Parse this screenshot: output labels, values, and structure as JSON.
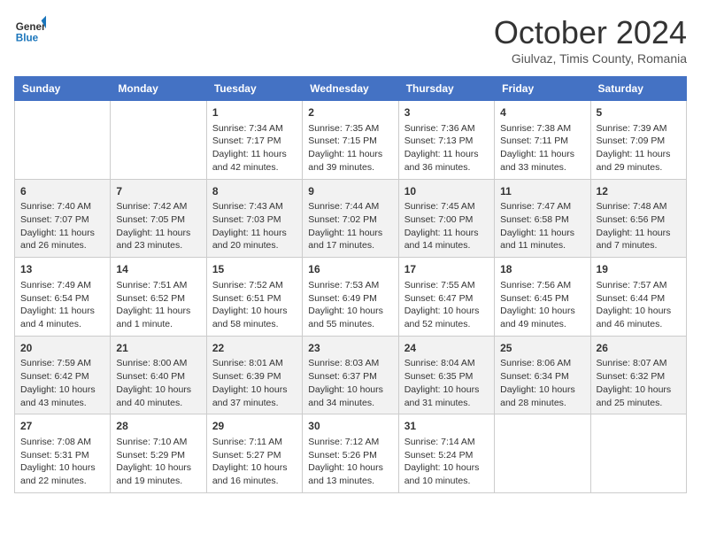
{
  "header": {
    "logo_line1": "General",
    "logo_line2": "Blue",
    "month": "October 2024",
    "location": "Giulvaz, Timis County, Romania"
  },
  "days_of_week": [
    "Sunday",
    "Monday",
    "Tuesday",
    "Wednesday",
    "Thursday",
    "Friday",
    "Saturday"
  ],
  "weeks": [
    [
      {
        "day": "",
        "sunrise": "",
        "sunset": "",
        "daylight": ""
      },
      {
        "day": "",
        "sunrise": "",
        "sunset": "",
        "daylight": ""
      },
      {
        "day": "1",
        "sunrise": "Sunrise: 7:34 AM",
        "sunset": "Sunset: 7:17 PM",
        "daylight": "Daylight: 11 hours and 42 minutes."
      },
      {
        "day": "2",
        "sunrise": "Sunrise: 7:35 AM",
        "sunset": "Sunset: 7:15 PM",
        "daylight": "Daylight: 11 hours and 39 minutes."
      },
      {
        "day": "3",
        "sunrise": "Sunrise: 7:36 AM",
        "sunset": "Sunset: 7:13 PM",
        "daylight": "Daylight: 11 hours and 36 minutes."
      },
      {
        "day": "4",
        "sunrise": "Sunrise: 7:38 AM",
        "sunset": "Sunset: 7:11 PM",
        "daylight": "Daylight: 11 hours and 33 minutes."
      },
      {
        "day": "5",
        "sunrise": "Sunrise: 7:39 AM",
        "sunset": "Sunset: 7:09 PM",
        "daylight": "Daylight: 11 hours and 29 minutes."
      }
    ],
    [
      {
        "day": "6",
        "sunrise": "Sunrise: 7:40 AM",
        "sunset": "Sunset: 7:07 PM",
        "daylight": "Daylight: 11 hours and 26 minutes."
      },
      {
        "day": "7",
        "sunrise": "Sunrise: 7:42 AM",
        "sunset": "Sunset: 7:05 PM",
        "daylight": "Daylight: 11 hours and 23 minutes."
      },
      {
        "day": "8",
        "sunrise": "Sunrise: 7:43 AM",
        "sunset": "Sunset: 7:03 PM",
        "daylight": "Daylight: 11 hours and 20 minutes."
      },
      {
        "day": "9",
        "sunrise": "Sunrise: 7:44 AM",
        "sunset": "Sunset: 7:02 PM",
        "daylight": "Daylight: 11 hours and 17 minutes."
      },
      {
        "day": "10",
        "sunrise": "Sunrise: 7:45 AM",
        "sunset": "Sunset: 7:00 PM",
        "daylight": "Daylight: 11 hours and 14 minutes."
      },
      {
        "day": "11",
        "sunrise": "Sunrise: 7:47 AM",
        "sunset": "Sunset: 6:58 PM",
        "daylight": "Daylight: 11 hours and 11 minutes."
      },
      {
        "day": "12",
        "sunrise": "Sunrise: 7:48 AM",
        "sunset": "Sunset: 6:56 PM",
        "daylight": "Daylight: 11 hours and 7 minutes."
      }
    ],
    [
      {
        "day": "13",
        "sunrise": "Sunrise: 7:49 AM",
        "sunset": "Sunset: 6:54 PM",
        "daylight": "Daylight: 11 hours and 4 minutes."
      },
      {
        "day": "14",
        "sunrise": "Sunrise: 7:51 AM",
        "sunset": "Sunset: 6:52 PM",
        "daylight": "Daylight: 11 hours and 1 minute."
      },
      {
        "day": "15",
        "sunrise": "Sunrise: 7:52 AM",
        "sunset": "Sunset: 6:51 PM",
        "daylight": "Daylight: 10 hours and 58 minutes."
      },
      {
        "day": "16",
        "sunrise": "Sunrise: 7:53 AM",
        "sunset": "Sunset: 6:49 PM",
        "daylight": "Daylight: 10 hours and 55 minutes."
      },
      {
        "day": "17",
        "sunrise": "Sunrise: 7:55 AM",
        "sunset": "Sunset: 6:47 PM",
        "daylight": "Daylight: 10 hours and 52 minutes."
      },
      {
        "day": "18",
        "sunrise": "Sunrise: 7:56 AM",
        "sunset": "Sunset: 6:45 PM",
        "daylight": "Daylight: 10 hours and 49 minutes."
      },
      {
        "day": "19",
        "sunrise": "Sunrise: 7:57 AM",
        "sunset": "Sunset: 6:44 PM",
        "daylight": "Daylight: 10 hours and 46 minutes."
      }
    ],
    [
      {
        "day": "20",
        "sunrise": "Sunrise: 7:59 AM",
        "sunset": "Sunset: 6:42 PM",
        "daylight": "Daylight: 10 hours and 43 minutes."
      },
      {
        "day": "21",
        "sunrise": "Sunrise: 8:00 AM",
        "sunset": "Sunset: 6:40 PM",
        "daylight": "Daylight: 10 hours and 40 minutes."
      },
      {
        "day": "22",
        "sunrise": "Sunrise: 8:01 AM",
        "sunset": "Sunset: 6:39 PM",
        "daylight": "Daylight: 10 hours and 37 minutes."
      },
      {
        "day": "23",
        "sunrise": "Sunrise: 8:03 AM",
        "sunset": "Sunset: 6:37 PM",
        "daylight": "Daylight: 10 hours and 34 minutes."
      },
      {
        "day": "24",
        "sunrise": "Sunrise: 8:04 AM",
        "sunset": "Sunset: 6:35 PM",
        "daylight": "Daylight: 10 hours and 31 minutes."
      },
      {
        "day": "25",
        "sunrise": "Sunrise: 8:06 AM",
        "sunset": "Sunset: 6:34 PM",
        "daylight": "Daylight: 10 hours and 28 minutes."
      },
      {
        "day": "26",
        "sunrise": "Sunrise: 8:07 AM",
        "sunset": "Sunset: 6:32 PM",
        "daylight": "Daylight: 10 hours and 25 minutes."
      }
    ],
    [
      {
        "day": "27",
        "sunrise": "Sunrise: 7:08 AM",
        "sunset": "Sunset: 5:31 PM",
        "daylight": "Daylight: 10 hours and 22 minutes."
      },
      {
        "day": "28",
        "sunrise": "Sunrise: 7:10 AM",
        "sunset": "Sunset: 5:29 PM",
        "daylight": "Daylight: 10 hours and 19 minutes."
      },
      {
        "day": "29",
        "sunrise": "Sunrise: 7:11 AM",
        "sunset": "Sunset: 5:27 PM",
        "daylight": "Daylight: 10 hours and 16 minutes."
      },
      {
        "day": "30",
        "sunrise": "Sunrise: 7:12 AM",
        "sunset": "Sunset: 5:26 PM",
        "daylight": "Daylight: 10 hours and 13 minutes."
      },
      {
        "day": "31",
        "sunrise": "Sunrise: 7:14 AM",
        "sunset": "Sunset: 5:24 PM",
        "daylight": "Daylight: 10 hours and 10 minutes."
      },
      {
        "day": "",
        "sunrise": "",
        "sunset": "",
        "daylight": ""
      },
      {
        "day": "",
        "sunrise": "",
        "sunset": "",
        "daylight": ""
      }
    ]
  ]
}
